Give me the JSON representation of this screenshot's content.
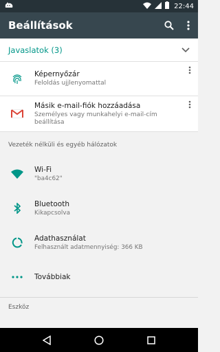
{
  "status_bar": {
    "time": "22:44",
    "icons": [
      "cat-icon",
      "wifi-icon",
      "signal-icon",
      "battery-icon"
    ]
  },
  "app_bar": {
    "title": "Beállítások",
    "icons": [
      "search-icon",
      "more-vert-icon"
    ]
  },
  "suggestions": {
    "header": "Javaslatok (3)",
    "items": [
      {
        "title": "Képernyőzár",
        "subtitle": "Feloldás ujjlenyomattal",
        "icon": "fingerprint-icon"
      },
      {
        "title": "Másik e-mail-fiók hozzáadása",
        "subtitle": "Személyes vagy munkahelyi e-mail-cím beállítása",
        "icon": "gmail-icon"
      }
    ]
  },
  "wireless_section": {
    "title": "Vezeték nélküli és egyéb hálózatok",
    "items": [
      {
        "title": "Wi-Fi",
        "subtitle": "\"ba4c62\"",
        "icon": "wifi-icon"
      },
      {
        "title": "Bluetooth",
        "subtitle": "Kikapcsolva",
        "icon": "bluetooth-icon"
      },
      {
        "title": "Adathasználat",
        "subtitle": "Felhasznált adatmennyiség: 366 KB",
        "icon": "data-usage-icon"
      },
      {
        "title": "Továbbiak",
        "subtitle": "",
        "icon": "more-horiz-icon"
      }
    ]
  },
  "device_section": {
    "title": "Eszköz"
  },
  "colors": {
    "accent": "#009688",
    "appbar": "#37474f",
    "statusbar": "#263238",
    "gmail_red": "#db4437"
  },
  "nav_bar": {
    "buttons": [
      "back-icon",
      "home-icon",
      "recents-icon"
    ]
  }
}
